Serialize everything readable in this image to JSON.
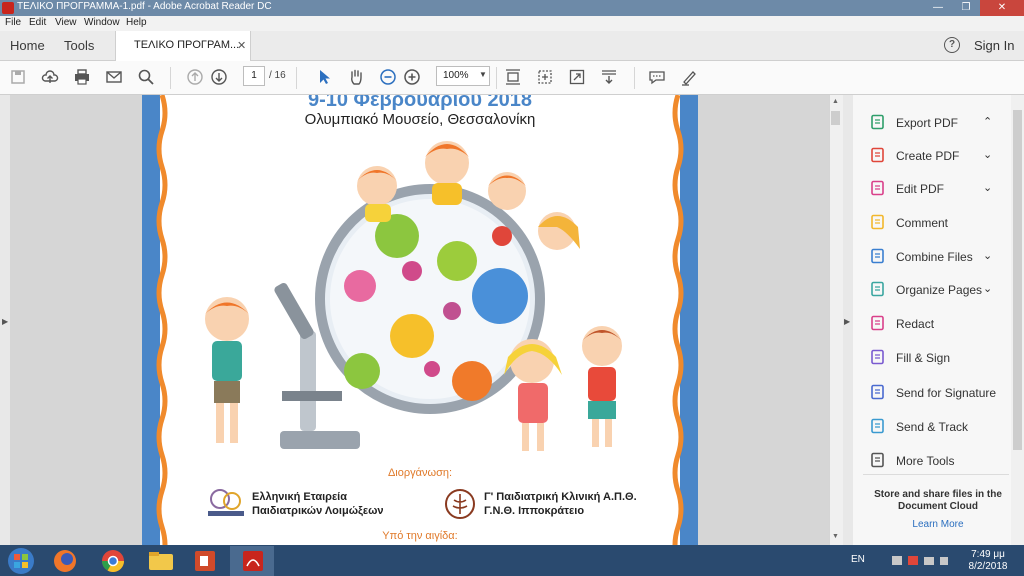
{
  "window": {
    "title": "ΤΕΛΙΚΟ ΠΡΟΓΡΑΜΜΑ-1.pdf - Adobe Acrobat Reader DC",
    "min": "—",
    "max": "❐",
    "close": "✕"
  },
  "menu": [
    "File",
    "Edit",
    "View",
    "Window",
    "Help"
  ],
  "tabs": {
    "home": "Home",
    "tools": "Tools",
    "doc": "ΤΕΛΙΚΟ ΠΡΟΓΡΑΜ...",
    "close": "✕"
  },
  "header": {
    "help": "?",
    "signin": "Sign In"
  },
  "toolbar": {
    "page": "1",
    "total": "/ 16",
    "zoom": "100%"
  },
  "document": {
    "date": "9-10 Φεβρουαρίου 2018",
    "venue": "Ολυμπιακό Μουσείο, Θεσσαλονίκη",
    "organizer_label": "Διοργάνωση:",
    "org1_line1": "Ελληνική Εταιρεία",
    "org1_line2": "Παιδιατρικών Λοιμώξεων",
    "org2_line1": "Γ' Παιδιατρική Κλινική Α.Π.Θ.",
    "org2_line2": "Γ.Ν.Θ. Ιπποκράτειο",
    "patron_label": "Υπό την αιγίδα:"
  },
  "tools_pane": {
    "items": [
      {
        "label": "Export PDF",
        "icon": "export-pdf-icon",
        "chevron": "⌃",
        "color": "#2e9e6a"
      },
      {
        "label": "Create PDF",
        "icon": "create-pdf-icon",
        "chevron": "⌄",
        "color": "#e0463a"
      },
      {
        "label": "Edit PDF",
        "icon": "edit-pdf-icon",
        "chevron": "⌄",
        "color": "#d9408a"
      },
      {
        "label": "Comment",
        "icon": "comment-icon",
        "chevron": "",
        "color": "#f2b72c"
      },
      {
        "label": "Combine Files",
        "icon": "combine-files-icon",
        "chevron": "⌄",
        "color": "#3a7fd0"
      },
      {
        "label": "Organize Pages",
        "icon": "organize-pages-icon",
        "chevron": "⌄",
        "color": "#3aa6a0"
      },
      {
        "label": "Redact",
        "icon": "redact-icon",
        "chevron": "",
        "color": "#d9408a"
      },
      {
        "label": "Fill & Sign",
        "icon": "fill-sign-icon",
        "chevron": "",
        "color": "#7a5ad0"
      },
      {
        "label": "Send for Signature",
        "icon": "send-signature-icon",
        "chevron": "",
        "color": "#4a6ad0"
      },
      {
        "label": "Send & Track",
        "icon": "send-track-icon",
        "chevron": "",
        "color": "#3a9ad0"
      },
      {
        "label": "More Tools",
        "icon": "more-tools-icon",
        "chevron": "",
        "color": "#555555"
      }
    ],
    "store_text": "Store and share files in the Document Cloud",
    "learn_more": "Learn More"
  },
  "taskbar": {
    "lang": "EN",
    "time": "7:49 μμ",
    "date": "8/2/2018"
  }
}
